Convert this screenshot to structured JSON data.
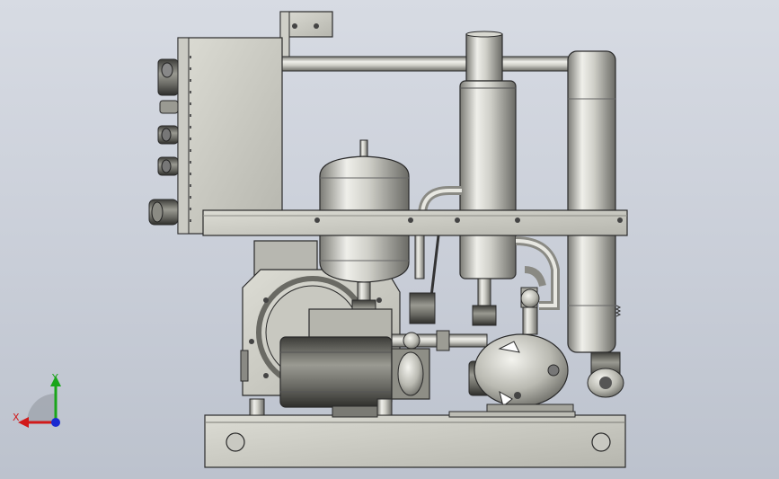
{
  "viewport": {
    "background_top": "#d7dbe3",
    "background_bottom": "#bcc2cd"
  },
  "triad": {
    "x_label": "X",
    "y_label": "Y",
    "x_color": "#d11a1a",
    "y_color": "#1aa51a",
    "z_color": "#1a2ad1"
  },
  "model": {
    "metal_light": "#e9e9e3",
    "metal_mid": "#b8b8b0",
    "metal_dark": "#6d6d68",
    "outline": "#2a2a2a",
    "components": [
      "control-box",
      "top-mounting-bracket",
      "horizontal-frame-bar",
      "upper-tie-rod",
      "vertical-receiver-cylinder",
      "expansion-tank",
      "right-heat-exchanger",
      "compressor-housing",
      "electric-motor",
      "accumulator-sphere",
      "base-plate"
    ]
  }
}
